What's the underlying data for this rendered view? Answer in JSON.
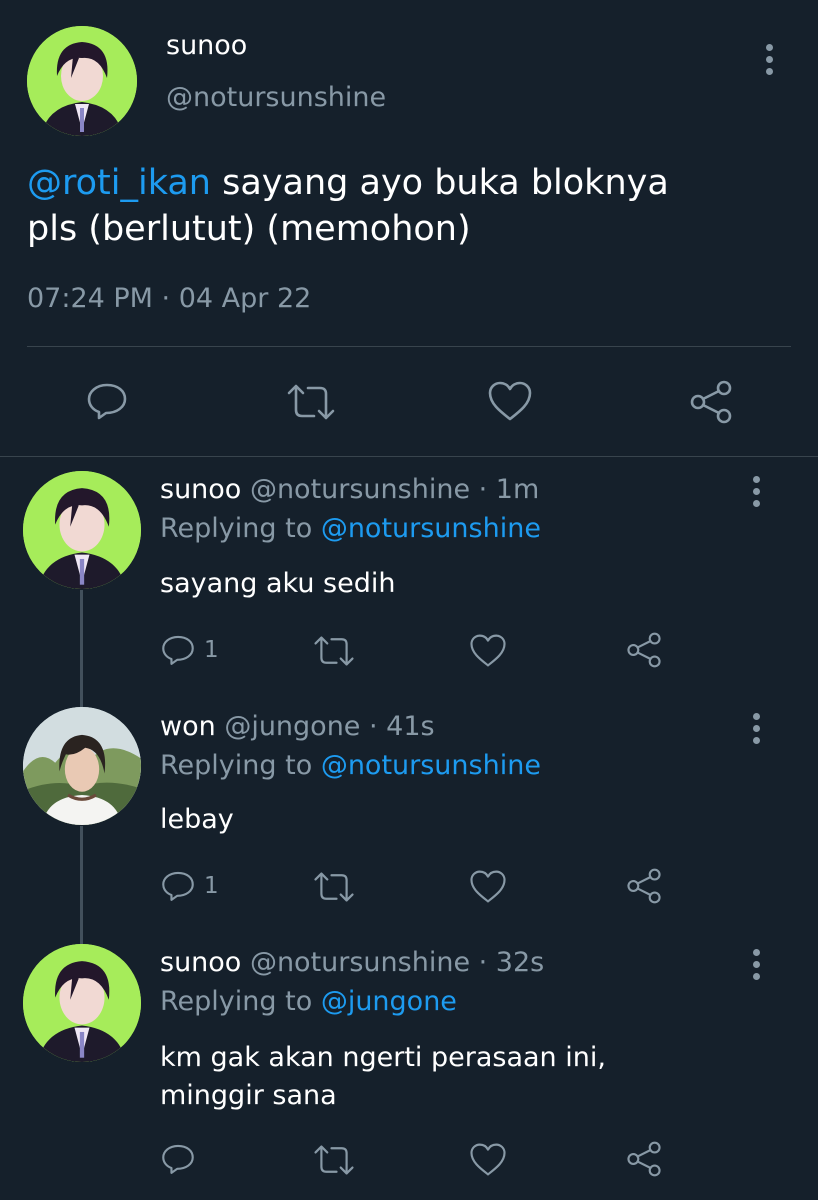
{
  "main_tweet": {
    "display_name": "sunoo",
    "handle": "@notursunshine",
    "mention": "@roti_ikan",
    "text_line1": " sayang ayo buka bloknya",
    "text_line2": "pls (berlutut) (memohon)",
    "timestamp": "07:24 PM · 04 Apr 22"
  },
  "replies": [
    {
      "display_name": "sunoo",
      "meta": "@notursunshine · 1m",
      "replying_prefix": "Replying to ",
      "replying_to": "@notursunshine",
      "text_line1": "sayang aku sedih",
      "text_line2": "",
      "reply_count": "1"
    },
    {
      "display_name": "won",
      "meta": "@jungone · 41s",
      "replying_prefix": "Replying to ",
      "replying_to": "@notursunshine",
      "text_line1": "lebay",
      "text_line2": "",
      "reply_count": "1"
    },
    {
      "display_name": "sunoo",
      "meta": "@notursunshine · 32s",
      "replying_prefix": "Replying to ",
      "replying_to": "@jungone",
      "text_line1": "km gak akan ngerti perasaan ini,",
      "text_line2": "minggir sana",
      "reply_count": ""
    }
  ],
  "icons": {
    "reply": "reply-icon",
    "retweet": "retweet-icon",
    "like": "like-icon",
    "share": "share-icon",
    "more": "more-icon"
  },
  "colors": {
    "background": "#15202b",
    "text": "#ffffff",
    "muted": "#8899a6",
    "link": "#1d9bf0",
    "avatar_bg": "#a6ec5a"
  }
}
